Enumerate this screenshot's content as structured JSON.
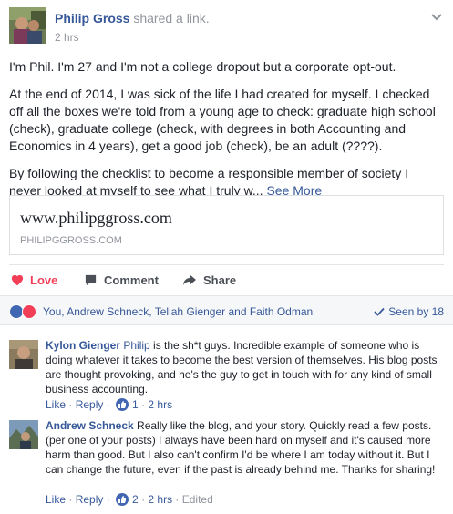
{
  "post": {
    "author": "Philip Gross",
    "action": " shared a link.",
    "time": "2 hrs",
    "paragraphs": [
      "I'm Phil. I'm 27 and I'm not a college dropout but a corporate opt-out.",
      "At the end of 2014, I was sick of the life I had created for myself. I checked off all the boxes we're told from a young age to check: graduate high school (check), graduate college (check, with degrees in both Accounting and Economics in 4 years), get a good job (check), be an adult (????).",
      "By following the checklist to become a responsible member of society I never looked at myself to see what I truly w... "
    ],
    "see_more": "See More"
  },
  "link": {
    "title": "www.philipggross.com",
    "domain": "PHILIPGGROSS.COM"
  },
  "actions": {
    "love": "Love",
    "comment": "Comment",
    "share": "Share"
  },
  "reactions": {
    "names": "You, Andrew Schneck, Teliah Gienger and Faith Odman",
    "seen_by": "Seen by 18"
  },
  "comments": [
    {
      "author": "Kylon Gienger",
      "mention": "Philip",
      "text": " is the sh*t guys. Incredible example of someone who is doing whatever it takes to become the best version of themselves. His blog posts are thought provoking, and he's the guy to get in touch with for any kind of small business accounting.",
      "like": "Like",
      "sep1": " · ",
      "reply": "Reply",
      "sep2": " · ",
      "likes": "1",
      "sep3": " · ",
      "time": "2 hrs",
      "edited": ""
    },
    {
      "author": "Andrew Schneck",
      "mention": "",
      "text": " Really like the blog, and your story. Quickly read a few posts. (per one of your posts) I always have been hard on myself and it's caused more harm than good. But I also can't confirm I'd be where I am today without it. But I can change the future, even if the past is already behind me. Thanks for sharing!",
      "like": "Like",
      "sep1": " · ",
      "reply": "Reply",
      "sep2": " · ",
      "likes": "2",
      "sep3": " · ",
      "time": "2 hrs",
      "edited": " · Edited"
    }
  ],
  "colors": {
    "link_blue": "#365899",
    "love_red": "#f33e58",
    "meta_gray": "#90949c",
    "like_blue": "#4267b2"
  }
}
